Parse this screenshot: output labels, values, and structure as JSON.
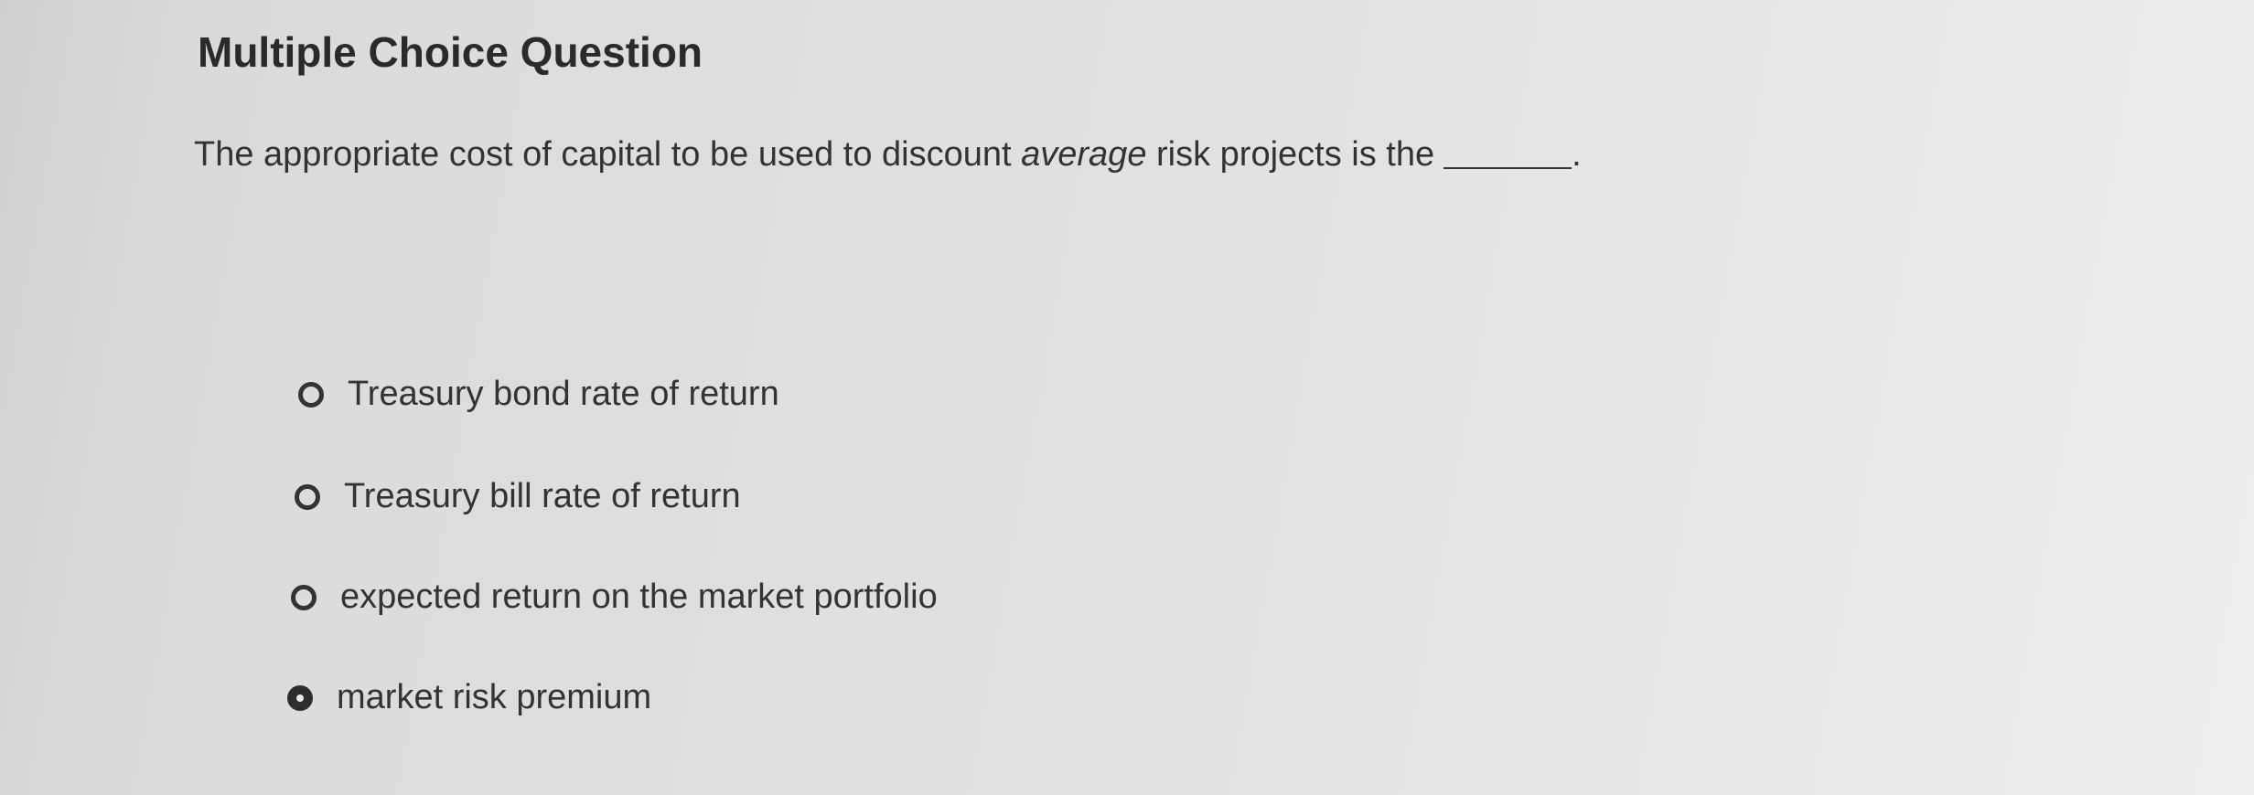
{
  "question": {
    "heading": "Multiple Choice Question",
    "prompt_before": "The appropriate cost of capital to be used to discount ",
    "prompt_emphasis": "average",
    "prompt_after": " risk projects is the",
    "prompt_end": "."
  },
  "options": [
    {
      "label": "Treasury bond rate of return",
      "selected": false
    },
    {
      "label": "Treasury bill rate of return",
      "selected": false
    },
    {
      "label": "expected return on the market portfolio",
      "selected": false
    },
    {
      "label": "market risk premium",
      "selected": true
    }
  ]
}
